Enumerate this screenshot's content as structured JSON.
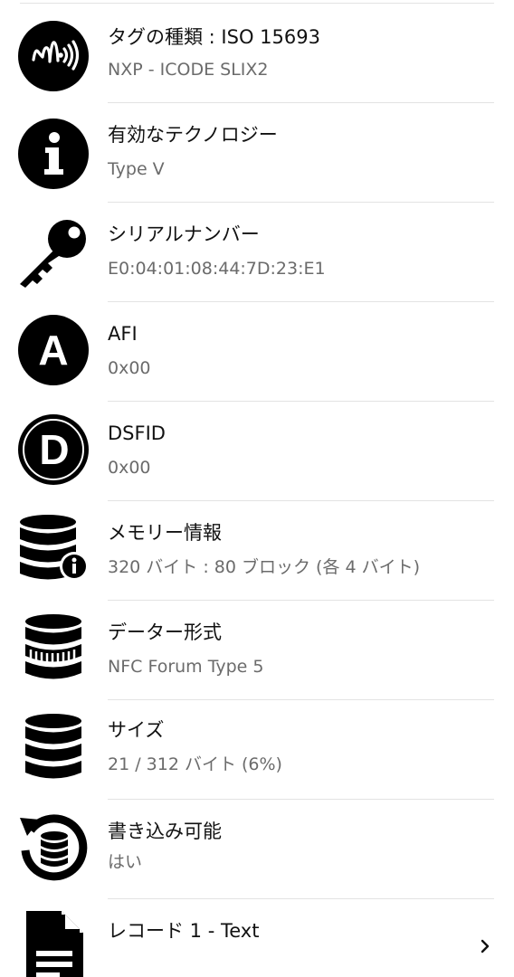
{
  "rows": [
    {
      "title": "タグの種類 : ISO 15693",
      "value": "NXP - ICODE SLIX2",
      "icon": "nfc-wave-icon"
    },
    {
      "title": "有効なテクノロジー",
      "value": "Type V",
      "icon": "info-icon"
    },
    {
      "title": "シリアルナンバー",
      "value": "E0:04:01:08:44:7D:23:E1",
      "icon": "key-icon"
    },
    {
      "title": "AFI",
      "value": "0x00",
      "icon": "letter-a-icon"
    },
    {
      "title": "DSFID",
      "value": "0x00",
      "icon": "letter-d-icon"
    },
    {
      "title": "メモリー情報",
      "value": "320 バイト : 80 ブロック (各 4 バイト)",
      "icon": "database-info-icon"
    },
    {
      "title": "データー形式",
      "value": "NFC Forum Type 5",
      "icon": "database-format-icon"
    },
    {
      "title": "サイズ",
      "value": "21 / 312 バイト (6%)",
      "icon": "database-icon"
    },
    {
      "title": "書き込み可能",
      "value": "はい",
      "icon": "database-rewrite-icon"
    },
    {
      "title": "レコード 1 - Text",
      "value": "",
      "icon": "document-icon"
    }
  ]
}
